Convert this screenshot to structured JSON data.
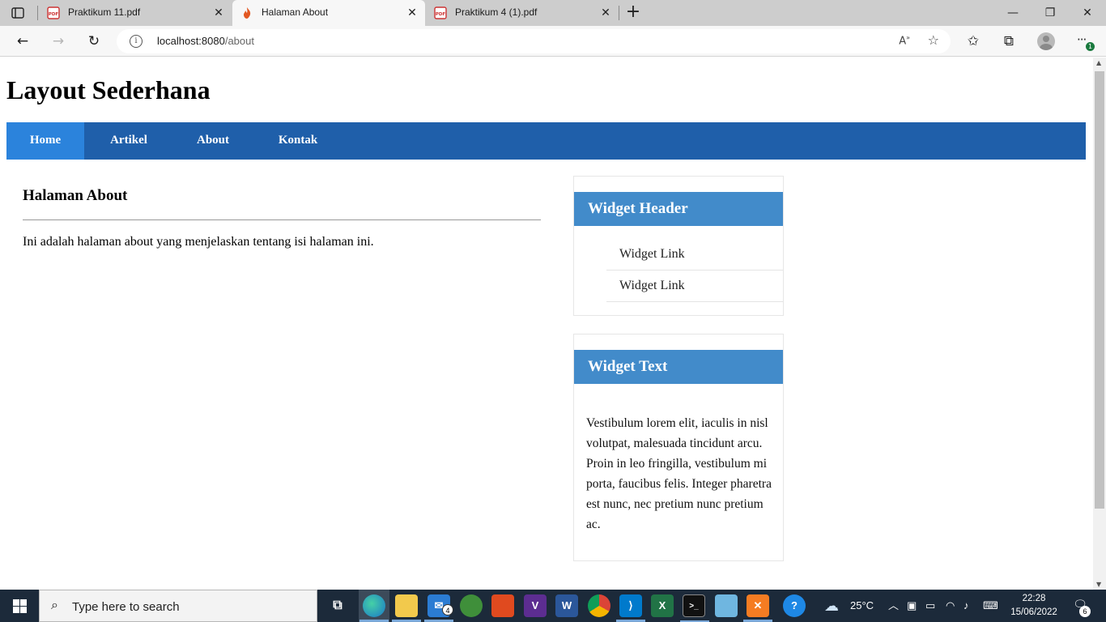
{
  "browser": {
    "tabs": [
      {
        "label": "Praktikum 11.pdf",
        "icon": "pdf-icon",
        "active": false
      },
      {
        "label": "Halaman About",
        "icon": "flame-icon",
        "active": true
      },
      {
        "label": "Praktikum 4 (1).pdf",
        "icon": "pdf-icon",
        "active": false
      }
    ],
    "url_host": "localhost:8080",
    "url_path": "/about",
    "reader_label": "A¹¸",
    "update_badge": "1"
  },
  "page": {
    "site_title": "Layout Sederhana",
    "nav": [
      {
        "label": "Home",
        "active": true
      },
      {
        "label": "Artikel",
        "active": false
      },
      {
        "label": "About",
        "active": false
      },
      {
        "label": "Kontak",
        "active": false
      }
    ],
    "main": {
      "heading": "Halaman About",
      "body": "Ini adalah halaman about yang menjelaskan tentang isi halaman ini."
    },
    "widget_links": {
      "header": "Widget Header",
      "links": [
        "Widget Link",
        "Widget Link"
      ]
    },
    "widget_text": {
      "header": "Widget Text",
      "body": "Vestibulum lorem elit, iaculis in nisl volutpat, malesuada tincidunt arcu. Proin in leo fringilla, vestibulum mi porta, faucibus felis. Integer pharetra est nunc, nec pretium nunc pretium ac."
    }
  },
  "taskbar": {
    "search_placeholder": "Type here to search",
    "mail_count": "4",
    "temperature": "25°C",
    "time": "22:28",
    "date": "15/06/2022",
    "notification_count": "6"
  },
  "colors": {
    "nav_bar": "#1f5faa",
    "nav_active": "#2b83dc",
    "widget_header": "#428bca"
  }
}
